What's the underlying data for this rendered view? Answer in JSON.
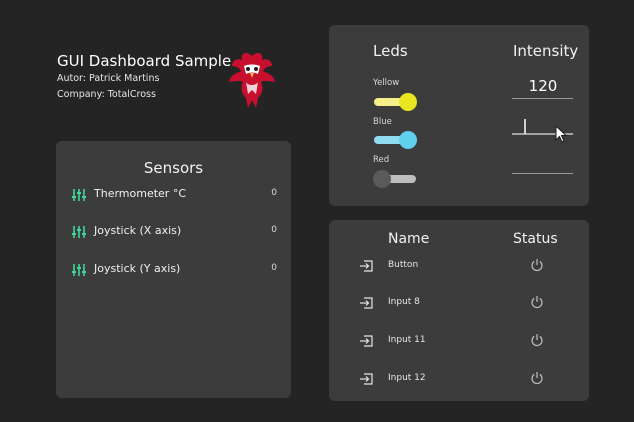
{
  "header": {
    "title": "GUI Dashboard Sample",
    "autor": "Autor: Patrick Martins",
    "company": "Company: TotalCross"
  },
  "sensors": {
    "title": "Sensors",
    "items": [
      {
        "label": "Thermometer °C",
        "value": "0",
        "icon": "sliders-icon"
      },
      {
        "label": "Joystick (X axis)",
        "value": "0",
        "icon": "sliders-icon"
      },
      {
        "label": "Joystick (Y axis)",
        "value": "0",
        "icon": "sliders-icon"
      }
    ]
  },
  "leds": {
    "title": "Leds",
    "items": [
      {
        "label": "Yellow",
        "on": true,
        "knob_color": "#e8e61e",
        "track_color": "#f4ef8a"
      },
      {
        "label": "Blue",
        "on": true,
        "knob_color": "#5fd0ee",
        "track_color": "#8fdcf0"
      },
      {
        "label": "Red",
        "on": false,
        "knob_color": "#5a5a5a",
        "track_color": "#bdbdbd"
      }
    ]
  },
  "intensity": {
    "title": "Intensity",
    "value": "120"
  },
  "io": {
    "name_header": "Name",
    "status_header": "Status",
    "rows": [
      {
        "name": "Button",
        "icon": "input-icon",
        "status_icon": "power-icon"
      },
      {
        "name": "Input 8",
        "icon": "input-icon",
        "status_icon": "power-icon"
      },
      {
        "name": "Input 11",
        "icon": "input-icon",
        "status_icon": "power-icon"
      },
      {
        "name": "Input 12",
        "icon": "input-icon",
        "status_icon": "power-icon"
      }
    ]
  }
}
